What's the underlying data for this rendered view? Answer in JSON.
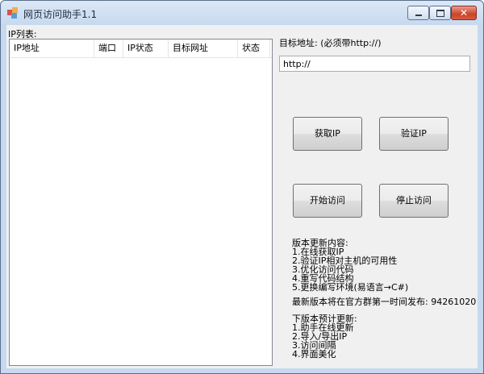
{
  "window": {
    "title": "网页访问助手1.1",
    "close_glyph": "✕"
  },
  "ip_list": {
    "label": "IP列表:",
    "columns": [
      "IP地址",
      "端口",
      "IP状态",
      "目标网址",
      "状态"
    ],
    "rows": []
  },
  "target": {
    "label": "目标地址: (必须带http://)",
    "value": "http://"
  },
  "buttons": {
    "get_ip": "获取IP",
    "verify_ip": "验证IP",
    "start": "开始访问",
    "stop": "停止访问"
  },
  "changelog": {
    "title": "版本更新内容:",
    "items": [
      "1.在线获取IP",
      "2.验证IP相对主机的可用性",
      "3.优化访问代码",
      "4.重写代码结构",
      "5.更换编写环境(易语言→C#)"
    ]
  },
  "release_note": "最新版本将在官方群第一时间发布: 94261020",
  "next_version": {
    "title": "下版本预计更新:",
    "items": [
      "1.助手在线更新",
      "2.导入/导出IP",
      "3.访问间隔",
      "4.界面美化"
    ]
  },
  "colors": {
    "frame": "#c6d9ef",
    "client": "#f0f0f0",
    "close_button": "#c8452c"
  }
}
